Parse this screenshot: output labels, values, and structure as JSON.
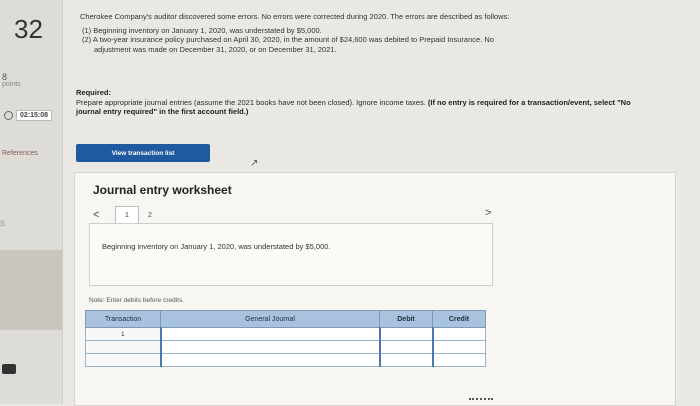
{
  "rail": {
    "question_number": "32",
    "points_value": "8",
    "points_label": "points",
    "timer": "02:15:08",
    "references": "References",
    "nav_letter": "s"
  },
  "intro": {
    "line1": "Cherokee Company's auditor discovered some errors. No errors were corrected during 2020. The errors are described as follows:",
    "item1": "(1) Beginning inventory on January 1, 2020, was understated by $5,000.",
    "item2": "(2) A two-year insurance policy purchased on April 30, 2020, in the amount of $24,600 was debited to Prepaid Insurance. No",
    "item2b": "adjustment was made on December 31, 2020, or on December 31, 2021."
  },
  "required": {
    "heading": "Required:",
    "text": "Prepare appropriate journal entries (assume the 2021 books have not been closed). Ignore income taxes.",
    "bold_text": "(If no entry is required for a transaction/event, select \"No journal entry required\" in the first account field.)"
  },
  "view_button": "View transaction list",
  "worksheet": {
    "title": "Journal entry worksheet",
    "prev_arrow": "<",
    "next_arrow": ">",
    "pages": [
      "1",
      "2"
    ],
    "description": "Beginning inventory on January 1, 2020, was understated by $5,000.",
    "note": "Note: Enter debits before credits.",
    "table": {
      "headers": [
        "Transaction",
        "General Journal",
        "Debit",
        "Credit"
      ],
      "rows": [
        {
          "transaction": "1",
          "account": "",
          "debit": "",
          "credit": ""
        },
        {
          "transaction": "",
          "account": "",
          "debit": "",
          "credit": ""
        },
        {
          "transaction": "",
          "account": "",
          "debit": "",
          "credit": ""
        }
      ]
    }
  }
}
